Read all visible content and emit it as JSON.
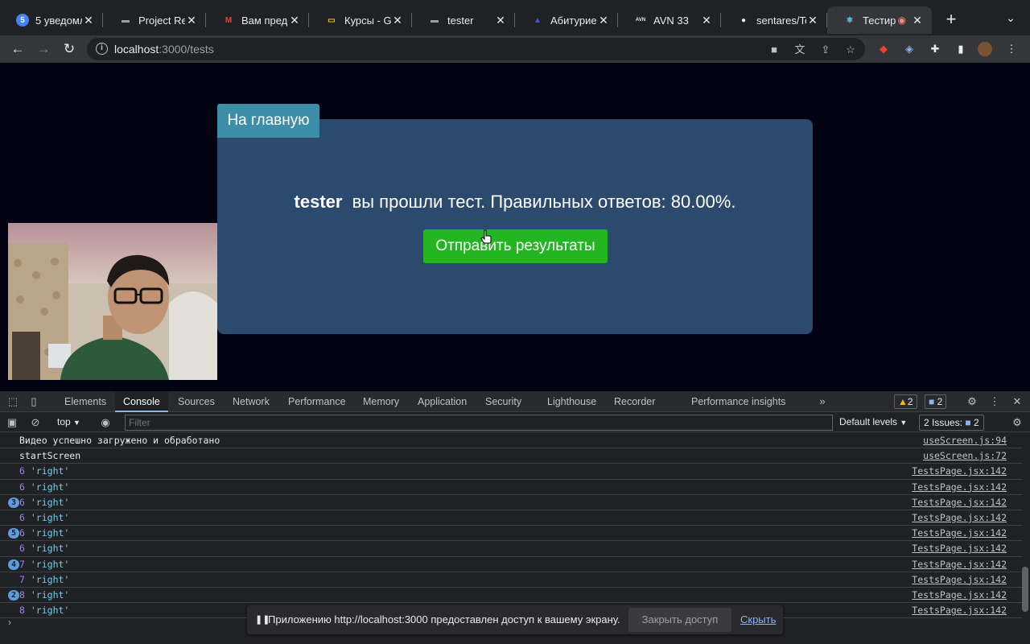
{
  "browser": {
    "tabs": [
      {
        "title": "5 уведомл",
        "favicon": "5",
        "favicon_color": "#4285f4"
      },
      {
        "title": "Project Rea",
        "favicon": "monitor-icon",
        "favicon_color": "#9aa0a6"
      },
      {
        "title": "Вам предо",
        "favicon": "M",
        "favicon_color": "#ea4335"
      },
      {
        "title": "Курсы - Go",
        "favicon": "slides-icon",
        "favicon_color": "#fbbc04"
      },
      {
        "title": "tester",
        "favicon": "monitor-icon",
        "favicon_color": "#9aa0a6"
      },
      {
        "title": "Абитуриен",
        "favicon": "cap-icon",
        "favicon_color": "#3b5bdb"
      },
      {
        "title": "AVN 33",
        "favicon": "AVN",
        "favicon_color": "#e8eaed"
      },
      {
        "title": "sentares/Te",
        "favicon": "github-icon",
        "favicon_color": "#e8eaed"
      },
      {
        "title": "Тестир",
        "favicon": "react-icon",
        "favicon_color": "#61dafb",
        "active": true,
        "recording": true
      }
    ],
    "new_tab": "+",
    "url_host": "localhost",
    "url_path": ":3000/tests"
  },
  "page": {
    "home_button": "На главную",
    "username": "tester",
    "result_text": "вы прошли тест. Правильных ответов: 80.00%.",
    "send_button": "Отправить результаты"
  },
  "devtools": {
    "tabs": [
      "Elements",
      "Console",
      "Sources",
      "Network",
      "Performance",
      "Memory",
      "Application",
      "Security",
      "Lighthouse",
      "Recorder",
      "Performance insights"
    ],
    "active_tab": "Console",
    "warnings_count": "2",
    "messages_count": "2",
    "context": "top",
    "filter_placeholder": "Filter",
    "levels": "Default levels",
    "issues": "2 Issues:",
    "issues_count": "2",
    "console_rows": [
      {
        "count": "",
        "text": "Видео успешно загружено и обработано",
        "num": "",
        "str": "",
        "source": "useScreen.js:94"
      },
      {
        "count": "",
        "text": "startScreen",
        "num": "",
        "str": "",
        "source": "useScreen.js:72"
      },
      {
        "count": "",
        "text": "",
        "num": "6",
        "str": "'right'",
        "source": "TestsPage.jsx:142"
      },
      {
        "count": "",
        "text": "",
        "num": "6",
        "str": "'right'",
        "source": "TestsPage.jsx:142"
      },
      {
        "count": "3",
        "text": "",
        "num": "6",
        "str": "'right'",
        "source": "TestsPage.jsx:142"
      },
      {
        "count": "",
        "text": "",
        "num": "6",
        "str": "'right'",
        "source": "TestsPage.jsx:142"
      },
      {
        "count": "5",
        "text": "",
        "num": "6",
        "str": "'right'",
        "source": "TestsPage.jsx:142"
      },
      {
        "count": "",
        "text": "",
        "num": "6",
        "str": "'right'",
        "source": "TestsPage.jsx:142"
      },
      {
        "count": "4",
        "text": "",
        "num": "7",
        "str": "'right'",
        "source": "TestsPage.jsx:142"
      },
      {
        "count": "",
        "text": "",
        "num": "7",
        "str": "'right'",
        "source": "TestsPage.jsx:142"
      },
      {
        "count": "2",
        "text": "",
        "num": "8",
        "str": "'right'",
        "source": "TestsPage.jsx:142"
      },
      {
        "count": "",
        "text": "",
        "num": "8",
        "str": "'right'",
        "source": "TestsPage.jsx:142"
      }
    ],
    "prompt": "›"
  },
  "share_bar": {
    "text": "Приложению http://localhost:3000 предоставлен доступ к вашему экрану.",
    "stop_button": "Закрыть доступ",
    "hide_link": "Скрыть"
  }
}
